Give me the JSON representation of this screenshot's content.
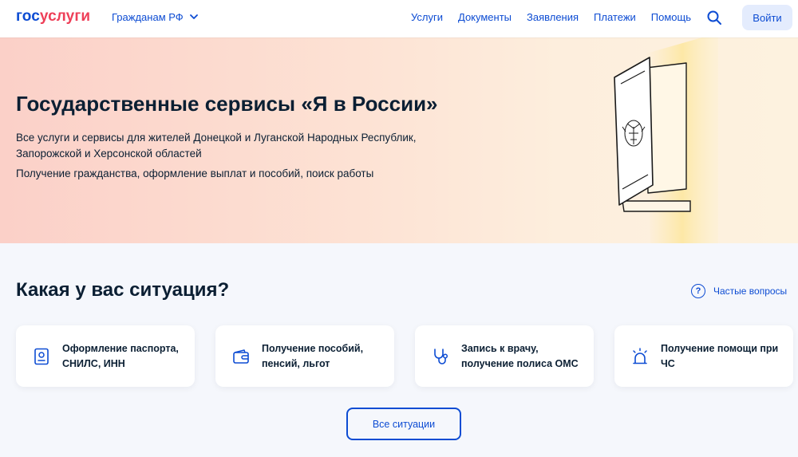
{
  "header": {
    "logo_part1": "гос",
    "logo_part2": "услуги",
    "citizen_label": "Гражданам РФ",
    "nav": [
      "Услуги",
      "Документы",
      "Заявления",
      "Платежи",
      "Помощь"
    ],
    "login_label": "Войти"
  },
  "hero": {
    "title": "Государственные сервисы «Я в России»",
    "desc1": "Все услуги и сервисы для жителей Донецкой и Луганской Народных Республик, Запорожской и Херсонской областей",
    "desc2": "Получение гражданства, оформление выплат и пособий, поиск работы"
  },
  "situations": {
    "title": "Какая у вас ситуация?",
    "faq_label": "Частые вопросы",
    "faq_icon": "?",
    "cards": [
      {
        "label": "Оформление паспорта, СНИЛС, ИНН",
        "icon": "passport-icon"
      },
      {
        "label": "Получение пособий, пенсий, льгот",
        "icon": "wallet-icon"
      },
      {
        "label": "Запись к врачу, получение полиса ОМС",
        "icon": "stethoscope-icon"
      },
      {
        "label": "Получение помощи при ЧС",
        "icon": "alarm-icon"
      }
    ],
    "all_button": "Все ситуации"
  },
  "colors": {
    "brand_blue": "#0d4cd3",
    "brand_red": "#ee3f58",
    "text_dark": "#0b1f33",
    "page_bg": "#f5f7fc"
  }
}
